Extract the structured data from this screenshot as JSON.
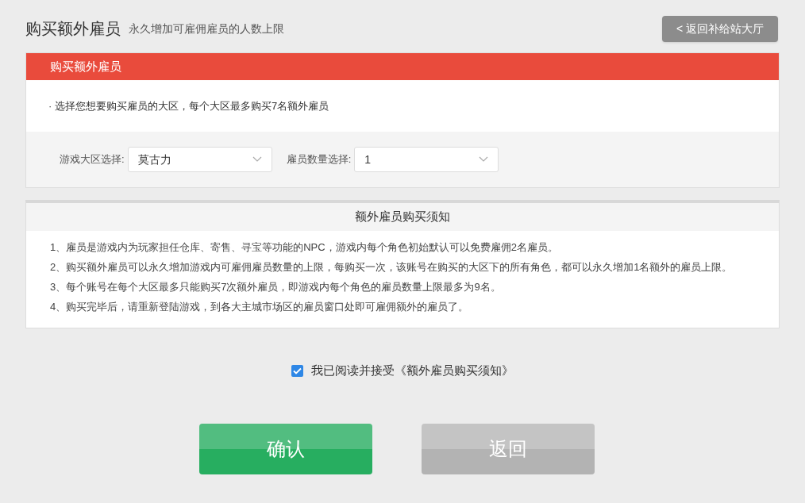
{
  "header": {
    "title": "购买额外雇员",
    "subtitle": "永久增加可雇佣雇员的人数上限",
    "back_button": "< 返回补给站大厅"
  },
  "purchase_panel": {
    "title": "购买额外雇员",
    "hint": "· 选择您想要购买雇员的大区，每个大区最多购买7名额外雇员",
    "fields": [
      {
        "label": "游戏大区选择:",
        "value": "莫古力"
      },
      {
        "label": "雇员数量选择:",
        "value": "1"
      }
    ]
  },
  "notice_panel": {
    "title": "额外雇员购买须知",
    "items": [
      "1、雇员是游戏内为玩家担任仓库、寄售、寻宝等功能的NPC，游戏内每个角色初始默认可以免费雇佣2名雇员。",
      "2、购买额外雇员可以永久增加游戏内可雇佣雇员数量的上限，每购买一次，该账号在购买的大区下的所有角色，都可以永久增加1名额外的雇员上限。",
      "3、每个账号在每个大区最多只能购买7次额外雇员，即游戏内每个角色的雇员数量上限最多为9名。",
      "4、购买完毕后，请重新登陆游戏，到各大主城市场区的雇员窗口处即可雇佣额外的雇员了。"
    ]
  },
  "agreement": {
    "label": "我已阅读并接受《额外雇员购买须知》",
    "checked": true
  },
  "buttons": [
    {
      "label": "确认",
      "kind": "primary"
    },
    {
      "label": "返回",
      "kind": "secondary"
    }
  ]
}
